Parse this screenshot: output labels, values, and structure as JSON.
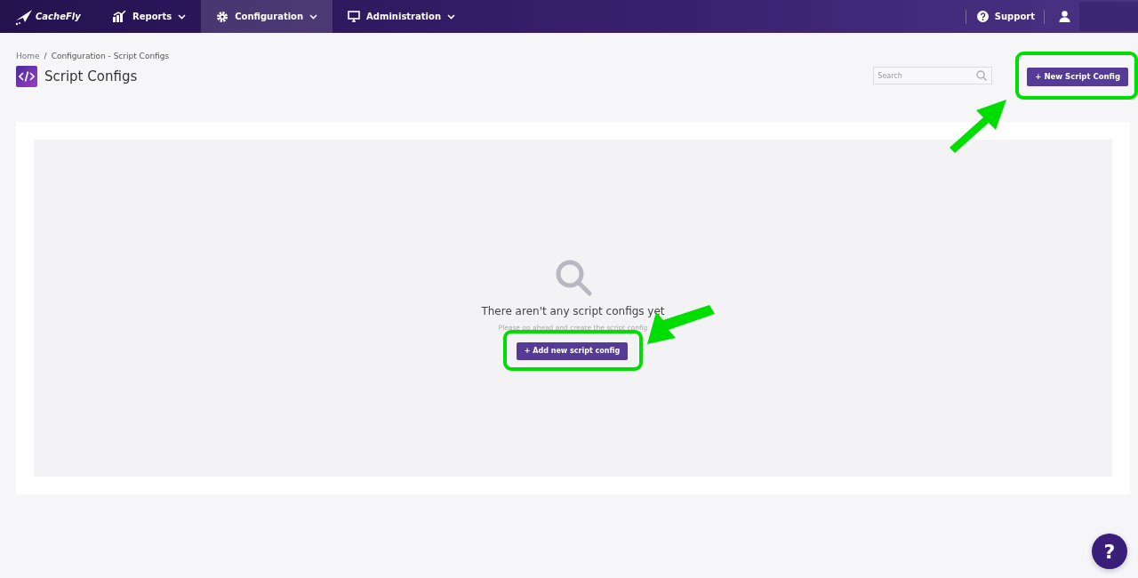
{
  "nav": {
    "logo": "CacheFly",
    "items": [
      {
        "label": "Reports",
        "selected": false
      },
      {
        "label": "Configuration",
        "selected": true
      },
      {
        "label": "Administration",
        "selected": false
      }
    ],
    "support": "Support"
  },
  "breadcrumb": [
    "Home",
    "/",
    "Configuration - Script Configs"
  ],
  "page_title": "Script Configs",
  "search": {
    "placeholder": "Search"
  },
  "new_button": "+ New Script Config",
  "empty": {
    "title": "There aren't any script configs yet",
    "subtitle": "Please go ahead and create the script config",
    "button": "+ Add new script config"
  },
  "help_button": "?"
}
